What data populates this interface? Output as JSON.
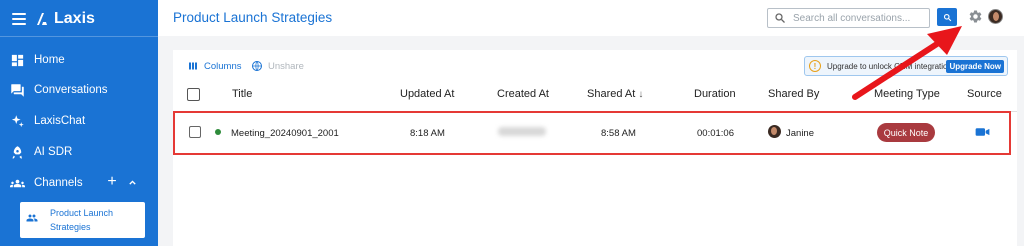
{
  "app": {
    "name": "Laxis"
  },
  "sidebar": {
    "items": [
      {
        "label": "Home",
        "icon": "dashboard-icon"
      },
      {
        "label": "Conversations",
        "icon": "chat-icon"
      },
      {
        "label": "LaxisChat",
        "icon": "sparkle-icon"
      },
      {
        "label": "AI SDR",
        "icon": "rocket-icon"
      },
      {
        "label": "Channels",
        "icon": "group-icon"
      }
    ],
    "channels_add": "+",
    "channels_collapse": "^",
    "active_channel": {
      "label": "Product Launch Strategies",
      "icon": "group-icon"
    }
  },
  "header": {
    "title": "Product Launch Strategies",
    "search_placeholder": "Search all conversations...",
    "icons": [
      "search-icon",
      "gear-icon",
      "avatar"
    ]
  },
  "toolbar": {
    "columns_label": "Columns",
    "unshare_label": "Unshare"
  },
  "upgrade_banner": {
    "message": "Upgrade to unlock CRM integration",
    "button_label": "Upgrade Now"
  },
  "table": {
    "columns": [
      "Title",
      "Updated At",
      "Created At",
      "Shared At",
      "Duration",
      "Shared By",
      "Meeting Type",
      "Source"
    ],
    "sort_indicator": "↓",
    "rows": [
      {
        "title": "Meeting_20240901_2001",
        "updated_at": "8:18 AM",
        "created_at": "",
        "shared_at": "8:58 AM",
        "duration": "00:01:06",
        "shared_by": "Janine",
        "meeting_type": "Quick Note",
        "source_icon": "video-camera-icon",
        "status_color": "#2e8b3a"
      }
    ]
  },
  "colors": {
    "brand": "#1a73d4",
    "badge": "#a93a3f",
    "highlight": "#e53935"
  }
}
